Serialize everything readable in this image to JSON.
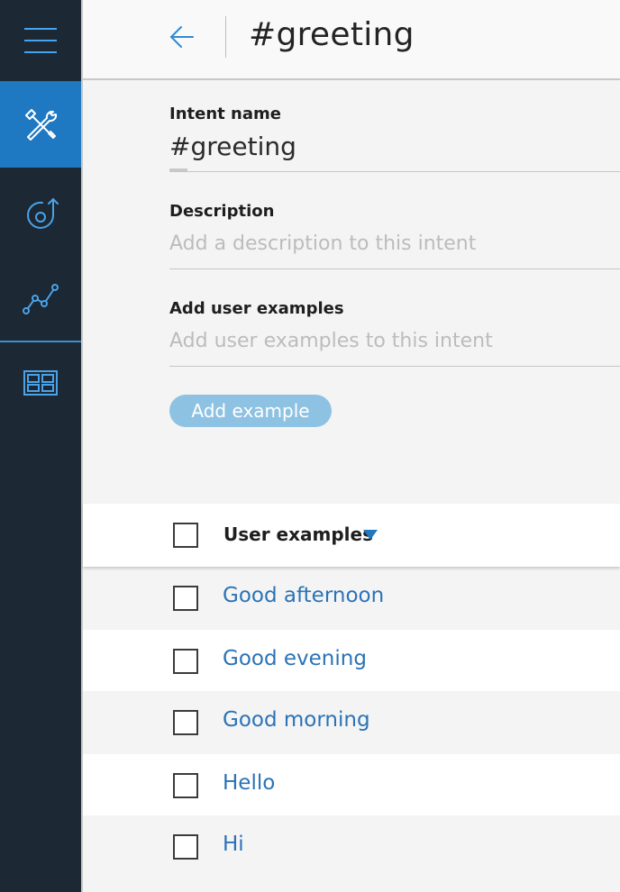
{
  "header": {
    "title": "#greeting"
  },
  "form": {
    "intent_name_label": "Intent name",
    "intent_name_value": "#greeting",
    "description_label": "Description",
    "description_placeholder": "Add a description to this intent",
    "examples_label": "Add user examples",
    "examples_placeholder": "Add user examples to this intent",
    "add_button": "Add example"
  },
  "table": {
    "column_header": "User examples",
    "rows": [
      "Good afternoon",
      "Good evening",
      "Good morning",
      "Hello",
      "Hi"
    ]
  },
  "colors": {
    "sidebar": "#1c2834",
    "active": "#1f78c2",
    "accent": "#2b73b6",
    "button": "#8ec2e2"
  },
  "icons": [
    "hamburger-icon",
    "tools-icon",
    "flow-icon",
    "analytics-icon",
    "catalog-icon",
    "arrow-left-icon",
    "sort-down-icon"
  ]
}
